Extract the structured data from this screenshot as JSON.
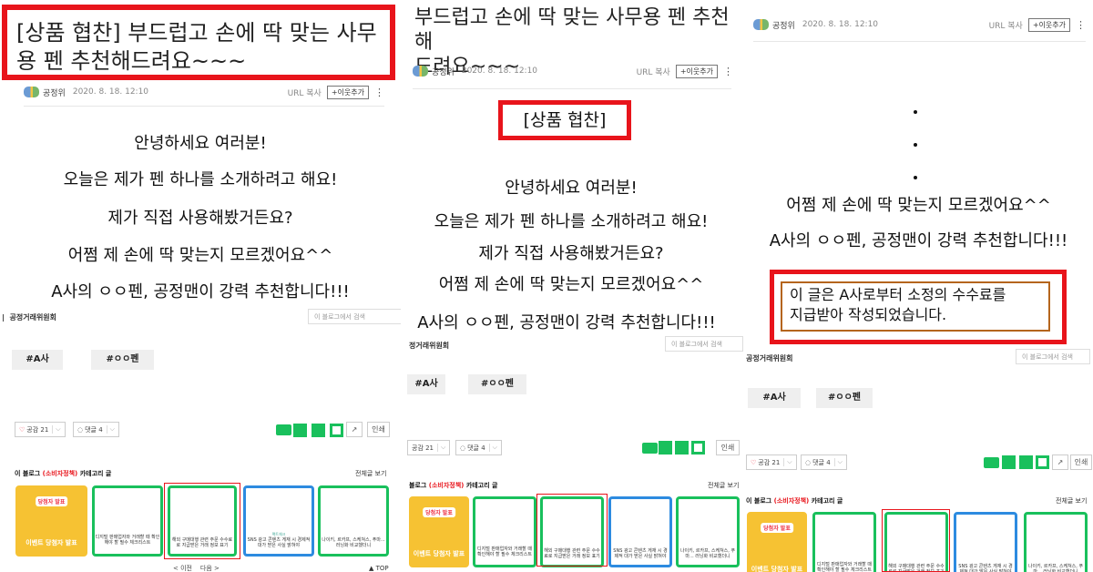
{
  "post": {
    "title_full": "[상품 협찬] 부드럽고 손에 딱 맞는 사무용 펜 추천해드려요~~~",
    "title_full_line1": "[상품 협찬] 부드럽고 손에 딱 맞는 사무",
    "title_full_line2": "용 펜 추천해드려요~~~",
    "title_short_line1": "부드럽고 손에 딱 맞는 사무용 펜 추천해",
    "title_short_line2": "드려요~~~",
    "author": "공정위",
    "date": "2020. 8. 18. 12:10",
    "url_copy": "URL 복사",
    "follow": "+이웃추가",
    "more": "⋮",
    "sponsor_label": "[상품 협찬]",
    "body": [
      "안녕하세요 여러분!",
      "오늘은 제가 펜 하나를 소개하려고 해요!",
      "제가 직접 사용해봤거든요?",
      "어쩜 제 손에 딱 맞는지 모르겠어요^^",
      "A사의 ㅇㅇ펜, 공정맨이 강력 추천합니다!!!"
    ],
    "body_line5_p2": "A사의 ㅇㅇ펜, 공정맨이 강력 추천합니다!!!",
    "disclosure_line1": "이 글은 A사로부터 소정의 수수료를",
    "disclosure_line2": "지급받아 작성되었습니다."
  },
  "blog": {
    "agency": "공정거래위원회",
    "agency_p2": "정거래위원회",
    "agency_p3": "공정거래위원회",
    "search_placeholder": "이 블로그에서 검색",
    "tags": [
      "#A사",
      "#ㅇㅇ펜"
    ],
    "like_label": "공감 21",
    "like_label_short": "공감 21",
    "comment_label": "댓글 4",
    "print": "인쇄",
    "category_prefix": "이 블로그",
    "category_name": "(소비자정책)",
    "category_suffix": "카테고리 글",
    "category_prefix_short": "블로그",
    "view_all": "전체글 보기",
    "prev": "< 이전",
    "next": "다음 >",
    "top": "▲ TOP",
    "thumbs": [
      {
        "badge": "당첨자 발표",
        "text": "이벤트 당첨자 발표"
      },
      {
        "text": "디지털 판매업자와 거래할 때 확인해야 할 필수 체크리스트"
      },
      {
        "text": "해외 구매대행 관련 주문 수수료로 지급받은 거래 정보 표기"
      },
      {
        "sub": "팩트체크",
        "text": "SNS 광고 콘텐츠 게재 시 경제적 대가 받은 사실 밝혀야"
      },
      {
        "text": "나이키, 르카프, 스케쳐스, 푸마... 러닝화 비교했더니"
      }
    ]
  },
  "colors": {
    "highlight": "#e8141b",
    "naver_green": "#19c05c",
    "disclosure_border": "#b5651d"
  }
}
